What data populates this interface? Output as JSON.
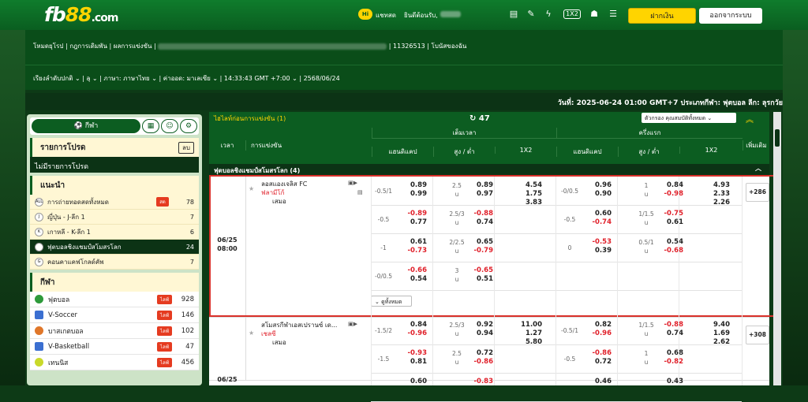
{
  "logo": {
    "main": "fb",
    "accent": "88",
    "suffix": ".com"
  },
  "top": {
    "chat": "แชทสด",
    "chat_badge": "Hi",
    "welcome": "ยินดีต้อนรับ,",
    "deposit": "ฝากเงิน",
    "logout": "ออกจากระบบ"
  },
  "nav1": {
    "items": [
      "โหมดยุโรป",
      "กฎการเดิมพัน",
      "ผลการแข่งขัน",
      "11326513",
      "โบนัสของฉัน"
    ]
  },
  "nav2": {
    "sort": "เรียงลำดับปกติ",
    "region": "ą",
    "language": "ภาษา: ภาษาไทย",
    "odds": "ค่าออด: มาเลเซีย",
    "clock": "14:33:43 GMT +7:00",
    "date": "2568/06/24"
  },
  "datebar": "วันที่: 2025-06-24 01:00 GMT+7 ประเภทกีฬา: ฟุตบอล ลีก: ลุรกวัย",
  "left": {
    "sport_btn": "กีฬา",
    "fav_title": "รายการโปรด",
    "fav_del": "ลบ",
    "fav_empty": "ไม่มีรายการโปรด",
    "rec_title": "แนะนำ",
    "rec": [
      {
        "name": "การถ่ายทอดสดทั้งหมด",
        "count": "78",
        "live": "สด",
        "icon": "ALL"
      },
      {
        "name": "ญี่ปุ่น - J-ลีก 1",
        "count": "7",
        "live": "",
        "icon": "J"
      },
      {
        "name": "เกาหลี - K-ลีก 1",
        "count": "6",
        "live": "",
        "icon": "K"
      },
      {
        "name": "ฟุตบอลชิงแชมป์สโมสรโลก",
        "count": "24",
        "live": "",
        "icon": "W"
      },
      {
        "name": "คอนคาแคฟโกลด์คัพ",
        "count": "7",
        "live": "",
        "icon": "G"
      }
    ],
    "sports_title": "กีฬา",
    "sports": [
      {
        "name": "ฟุตบอล",
        "count": "928",
        "live": "ไลฟ์",
        "color": "#2d9a3a"
      },
      {
        "name": "V-Soccer",
        "count": "146",
        "live": "ไลฟ์",
        "color": "#3b6fd1"
      },
      {
        "name": "บาสเกตบอล",
        "count": "102",
        "live": "ไลฟ์",
        "color": "#e0772a"
      },
      {
        "name": "V-Basketball",
        "count": "47",
        "live": "ไลฟ์",
        "color": "#3b6fd1"
      },
      {
        "name": "เทนนิส",
        "count": "456",
        "live": "ไลฟ์",
        "color": "#c9d92a"
      }
    ]
  },
  "main": {
    "upcoming": "ไฮไลท์ก่อนการแข่งขัน (1)",
    "refresh_count": "47",
    "filter": "ตัวกรอง คุณสมบัติทั้งหมด",
    "hdr": {
      "time": "เวลา",
      "event": "การแข่งขัน",
      "full": "เต็มเวลา",
      "half": "ครึ่งแรก",
      "hdp": "แฮนดิแคป",
      "ou": "สูง / ต่ำ",
      "x12": "1X2",
      "more": "เพิ่มเติม"
    },
    "league": "ฟุตบอลชิงแชมป์สโมสรโลก (4)",
    "m1": {
      "date": "06/25",
      "time": "08:00",
      "home": "ลอสแองเจลิส FC",
      "away": "ฟลามีโก้",
      "draw": "เสมอ",
      "more": "+286",
      "expand": "ดูทั้งหมด",
      "rows": [
        {
          "fh": "-0.5/1",
          "fhh": "0.89",
          "fha": "0.99",
          "fo": "2.5",
          "fou": "u",
          "foo": "0.89",
          "fou2": "0.97",
          "x1": "4.54",
          "xx": "1.75",
          "x2": "3.83",
          "hh": "-0/0.5",
          "hhh": "0.96",
          "hha": "0.90",
          "ho": "1",
          "hou": "u",
          "hoo": "0.84",
          "hoo2": "-0.98",
          "y1": "4.93",
          "yx": "2.33",
          "y2": "2.26"
        },
        {
          "fh": "-0.5",
          "fhh": "-0.89",
          "fha": "0.77",
          "fo": "2.5/3",
          "fou": "u",
          "foo": "-0.88",
          "fou2": "0.74",
          "hh": "-0.5",
          "hhh": "0.60",
          "hha": "-0.74",
          "ho": "1/1.5",
          "hou": "u",
          "hoo": "-0.75",
          "hoo2": "0.61"
        },
        {
          "fh": "-1",
          "fhh": "0.61",
          "fha": "-0.73",
          "fo": "2/2.5",
          "fou": "u",
          "foo": "0.65",
          "fou2": "-0.79",
          "hh": "0",
          "hhh": "-0.53",
          "hha": "0.39",
          "ho": "0.5/1",
          "hou": "u",
          "hoo": "0.54",
          "hoo2": "-0.68"
        },
        {
          "fh": "-0/0.5",
          "fhh": "-0.66",
          "fha": "0.54",
          "fo": "3",
          "fou": "u",
          "foo": "-0.65",
          "fou2": "0.51"
        }
      ]
    },
    "m2": {
      "date": "06/25",
      "home": "สโมสรกีฬาเอสเปรานซ์ เด...",
      "away": "เชลซี",
      "draw": "เสมอ",
      "more": "+308",
      "rows": [
        {
          "fh": "-1.5/2",
          "fhh": "0.84",
          "fha": "-0.96",
          "fo": "2.5/3",
          "fou": "u",
          "foo": "0.92",
          "fou2": "0.94",
          "x1": "11.00",
          "xx": "1.27",
          "x2": "5.80",
          "hh": "-0.5/1",
          "hhh": "0.82",
          "hha": "-0.96",
          "ho": "1/1.5",
          "hou": "u",
          "hoo": "-0.88",
          "hoo2": "0.74",
          "y1": "9.40",
          "yx": "1.69",
          "y2": "2.62"
        },
        {
          "fh": "-1.5",
          "fhh": "-0.93",
          "fha": "0.81",
          "fo": "2.5",
          "fou": "u",
          "foo": "0.72",
          "fou2": "-0.86",
          "hh": "-0.5",
          "hhh": "-0.86",
          "hha": "0.72",
          "ho": "1",
          "hou": "u",
          "hoo": "0.68",
          "hoo2": "-0.82"
        },
        {
          "fhh": "0.60",
          "foo": "-0.83",
          "hhh": "0.46",
          "hoo": "0.43"
        }
      ]
    }
  }
}
